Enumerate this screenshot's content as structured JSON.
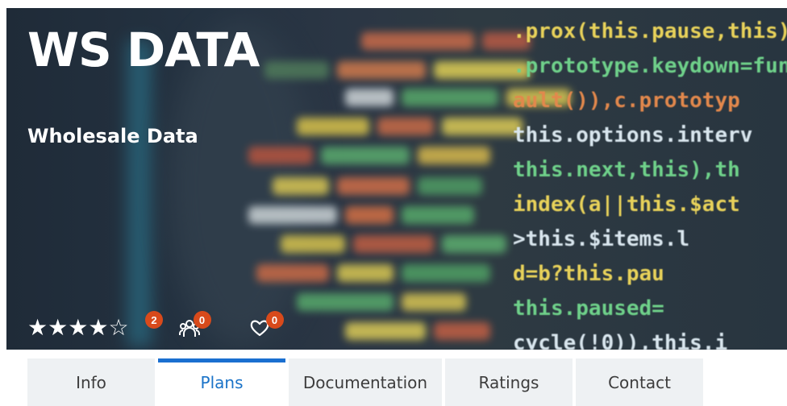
{
  "hero": {
    "title": "WS DATA",
    "subtitle": "Wholesale Data",
    "code_lines": [
      ".prox(this.pause,this)).on(",
      ".prototype.keydown=functio",
      "ault()),c.prototyp",
      "this.options.interv",
      "this.next,this),th",
      "index(a||this.$act",
      ">this.$items.l",
      "d=b?this.pau",
      "this.paused=",
      "cycle(!0)),this.i"
    ]
  },
  "metrics": {
    "rating": {
      "value": 4,
      "max": 5,
      "count": "2"
    },
    "subscribers": {
      "count": "0",
      "icon": "users-icon"
    },
    "favorites": {
      "count": "0",
      "icon": "heart-icon"
    }
  },
  "tabs": [
    {
      "label": "Info",
      "active": false
    },
    {
      "label": "Plans",
      "active": true
    },
    {
      "label": "Documentation",
      "active": false
    },
    {
      "label": "Ratings",
      "active": false
    },
    {
      "label": "Contact",
      "active": false
    }
  ],
  "colors": {
    "accent": "#1a6fd0",
    "badge": "#d84a1b",
    "tab_bg": "#eef1f3"
  }
}
